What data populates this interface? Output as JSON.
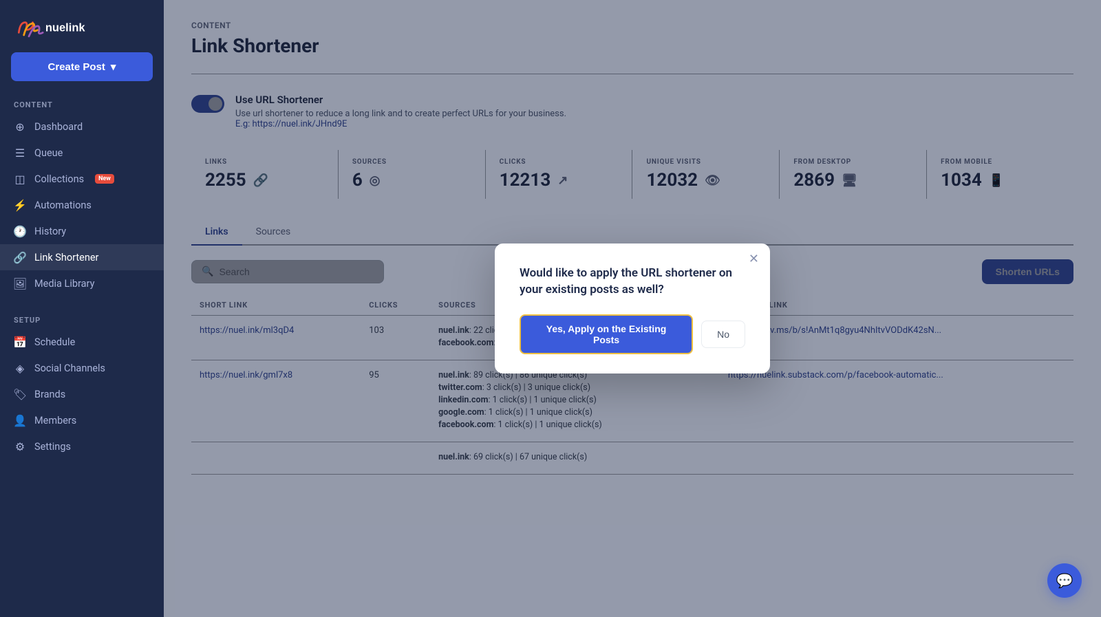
{
  "sidebar": {
    "logo_text": "nuelink",
    "create_post_label": "Create Post",
    "sections": [
      {
        "label": "CONTENT",
        "items": [
          {
            "id": "dashboard",
            "label": "Dashboard",
            "icon": "⊕",
            "active": false
          },
          {
            "id": "queue",
            "label": "Queue",
            "icon": "☰",
            "active": false
          },
          {
            "id": "collections",
            "label": "Collections",
            "icon": "◫",
            "badge": "New",
            "active": false
          },
          {
            "id": "automations",
            "label": "Automations",
            "icon": "⚡",
            "active": false
          },
          {
            "id": "history",
            "label": "History",
            "icon": "🕐",
            "active": false
          },
          {
            "id": "link-shortener",
            "label": "Link Shortener",
            "icon": "🔗",
            "active": true
          },
          {
            "id": "media-library",
            "label": "Media Library",
            "icon": "🖼",
            "active": false
          }
        ]
      },
      {
        "label": "SETUP",
        "items": [
          {
            "id": "schedule",
            "label": "Schedule",
            "icon": "📅",
            "active": false
          },
          {
            "id": "social-channels",
            "label": "Social Channels",
            "icon": "◈",
            "active": false
          },
          {
            "id": "brands",
            "label": "Brands",
            "icon": "🏷",
            "active": false
          },
          {
            "id": "members",
            "label": "Members",
            "icon": "👤",
            "active": false
          },
          {
            "id": "settings",
            "label": "Settings",
            "icon": "⚙",
            "active": false
          }
        ]
      }
    ]
  },
  "header": {
    "breadcrumb": "CONTENT",
    "title": "Link Shortener"
  },
  "toggle": {
    "label": "Use URL Shortener",
    "description": "Use url shortener to reduce a long link and to create perfect URLs for your business.",
    "example": "E.g: https://nuel.ink/JHnd9E",
    "enabled": true
  },
  "stats": [
    {
      "label": "LINKS",
      "value": "2255",
      "icon": "🔗"
    },
    {
      "label": "SOURCES",
      "value": "6",
      "icon": "◎"
    },
    {
      "label": "CLICKS",
      "value": "12213",
      "icon": "↗"
    },
    {
      "label": "UNIQUE VISITS",
      "value": "12032",
      "icon": "👁"
    },
    {
      "label": "FROM DESKTOP",
      "value": "2869",
      "icon": "🖥"
    },
    {
      "label": "FROM MOBILE",
      "value": "1034",
      "icon": "📱"
    }
  ],
  "tabs": [
    {
      "label": "Links",
      "active": true
    },
    {
      "label": "Sources",
      "active": false
    }
  ],
  "search": {
    "placeholder": "Search"
  },
  "shorten_btn": "Shorten URLs",
  "table": {
    "columns": [
      "SHORT LINK",
      "CLICKS",
      "SOURCES",
      "ORIGINAL LINK"
    ],
    "rows": [
      {
        "short_link": "https://nuel.ink/ml3qD4",
        "clicks": "103",
        "sources": [
          "nuel.ink: 22 click(s)  |  18 unique click(s)",
          "facebook.com: 81 click(s)  |  71 unique click(s)"
        ],
        "original_link": "https://1drv.ms/b/s!AnMt1q8gyu4NhItvVODdK42sN..."
      },
      {
        "short_link": "https://nuel.ink/gml7x8",
        "clicks": "95",
        "sources": [
          "nuel.ink: 89 click(s)  |  86 unique click(s)",
          "twitter.com: 3 click(s)  |  3 unique click(s)",
          "linkedin.com: 1 click(s)  |  1 unique click(s)",
          "google.com: 1 click(s)  |  1 unique click(s)",
          "facebook.com: 1 click(s)  |  1 unique click(s)"
        ],
        "original_link": "https://nuelink.substack.com/p/facebook-automatic..."
      },
      {
        "short_link": "",
        "clicks": "",
        "sources": [
          "nuel.ink: 69 click(s)  |  67 unique click(s)"
        ],
        "original_link": ""
      }
    ]
  },
  "modal": {
    "question": "Would like to apply the URL shortener on your existing posts as well?",
    "yes_label": "Yes, Apply on the Existing Posts",
    "no_label": "No"
  },
  "support": {
    "icon": "💬"
  }
}
